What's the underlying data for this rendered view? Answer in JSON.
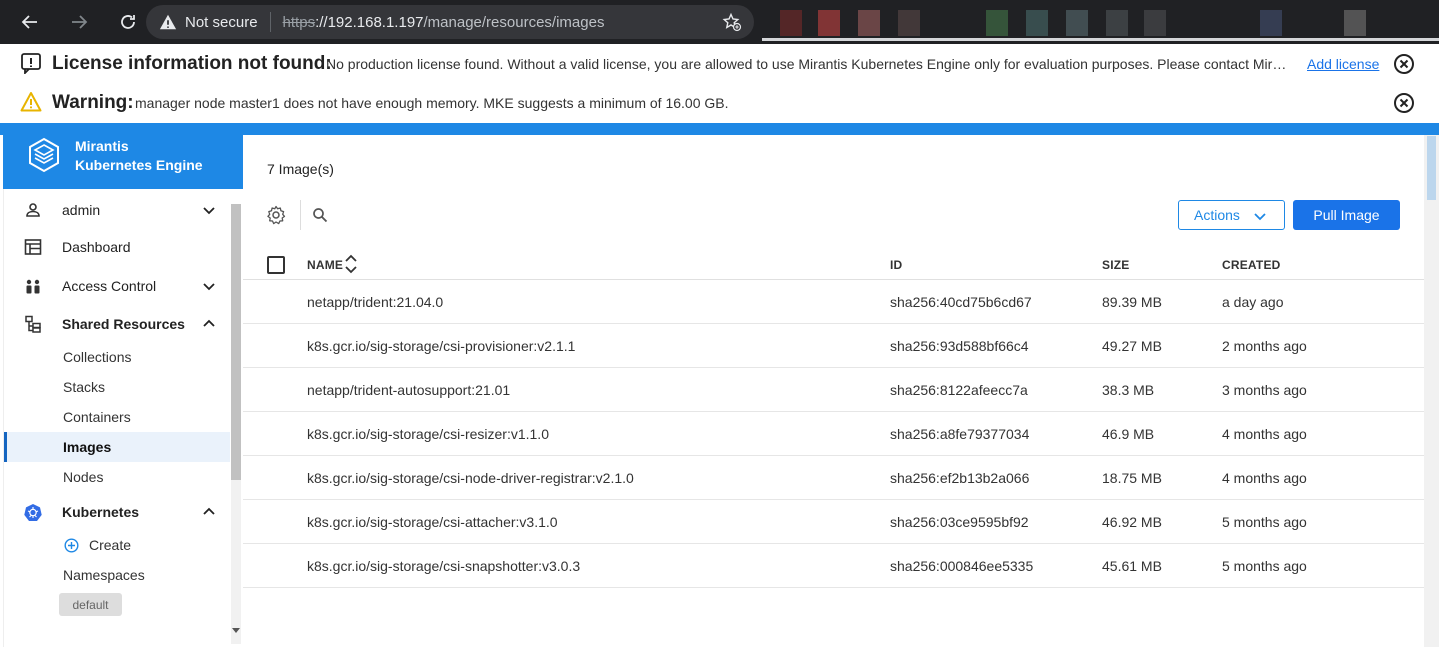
{
  "browser": {
    "security_label": "Not secure",
    "url_scheme": "https",
    "url_host": "://192.168.1.197",
    "url_path": "/manage/resources/images"
  },
  "banners": {
    "license": {
      "title": "License information not found:",
      "message": "No production license found. Without a valid license, you are allowed to use Mirantis Kubernetes Engine only for evaluation purposes. Please contact Mirantis to obtain a license.",
      "link": "Add license"
    },
    "warning": {
      "title": "Warning:",
      "message": "manager node master1 does not have enough memory. MKE suggests a minimum of 16.00 GB."
    }
  },
  "brand": {
    "line1": "Mirantis",
    "line2": "Kubernetes Engine",
    "color": "#1e88e5"
  },
  "sidebar": {
    "user": "admin",
    "dashboard": "Dashboard",
    "access_control": "Access Control",
    "shared_resources": "Shared Resources",
    "shared_items": [
      "Collections",
      "Stacks",
      "Containers",
      "Images",
      "Nodes"
    ],
    "active_item": "Images",
    "kubernetes": "Kubernetes",
    "kube_create": "Create",
    "kube_namespaces": "Namespaces",
    "namespace_chip": "default"
  },
  "main": {
    "count_label": "7 Image(s)",
    "actions_label": "Actions",
    "pull_label": "Pull Image",
    "columns": [
      "NAME",
      "ID",
      "SIZE",
      "CREATED"
    ],
    "rows": [
      {
        "name": "netapp/trident:21.04.0",
        "id": "sha256:40cd75b6cd67",
        "size": "89.39 MB",
        "created": "a day ago"
      },
      {
        "name": "k8s.gcr.io/sig-storage/csi-provisioner:v2.1.1",
        "id": "sha256:93d588bf66c4",
        "size": "49.27 MB",
        "created": "2 months ago"
      },
      {
        "name": "netapp/trident-autosupport:21.01",
        "id": "sha256:8122afeecc7a",
        "size": "38.3 MB",
        "created": "3 months ago"
      },
      {
        "name": "k8s.gcr.io/sig-storage/csi-resizer:v1.1.0",
        "id": "sha256:a8fe79377034",
        "size": "46.9 MB",
        "created": "4 months ago"
      },
      {
        "name": "k8s.gcr.io/sig-storage/csi-node-driver-registrar:v2.1.0",
        "id": "sha256:ef2b13b2a066",
        "size": "18.75 MB",
        "created": "4 months ago"
      },
      {
        "name": "k8s.gcr.io/sig-storage/csi-attacher:v3.1.0",
        "id": "sha256:03ce9595bf92",
        "size": "46.92 MB",
        "created": "5 months ago"
      },
      {
        "name": "k8s.gcr.io/sig-storage/csi-snapshotter:v3.0.3",
        "id": "sha256:000846ee5335",
        "size": "45.61 MB",
        "created": "5 months ago"
      }
    ]
  }
}
